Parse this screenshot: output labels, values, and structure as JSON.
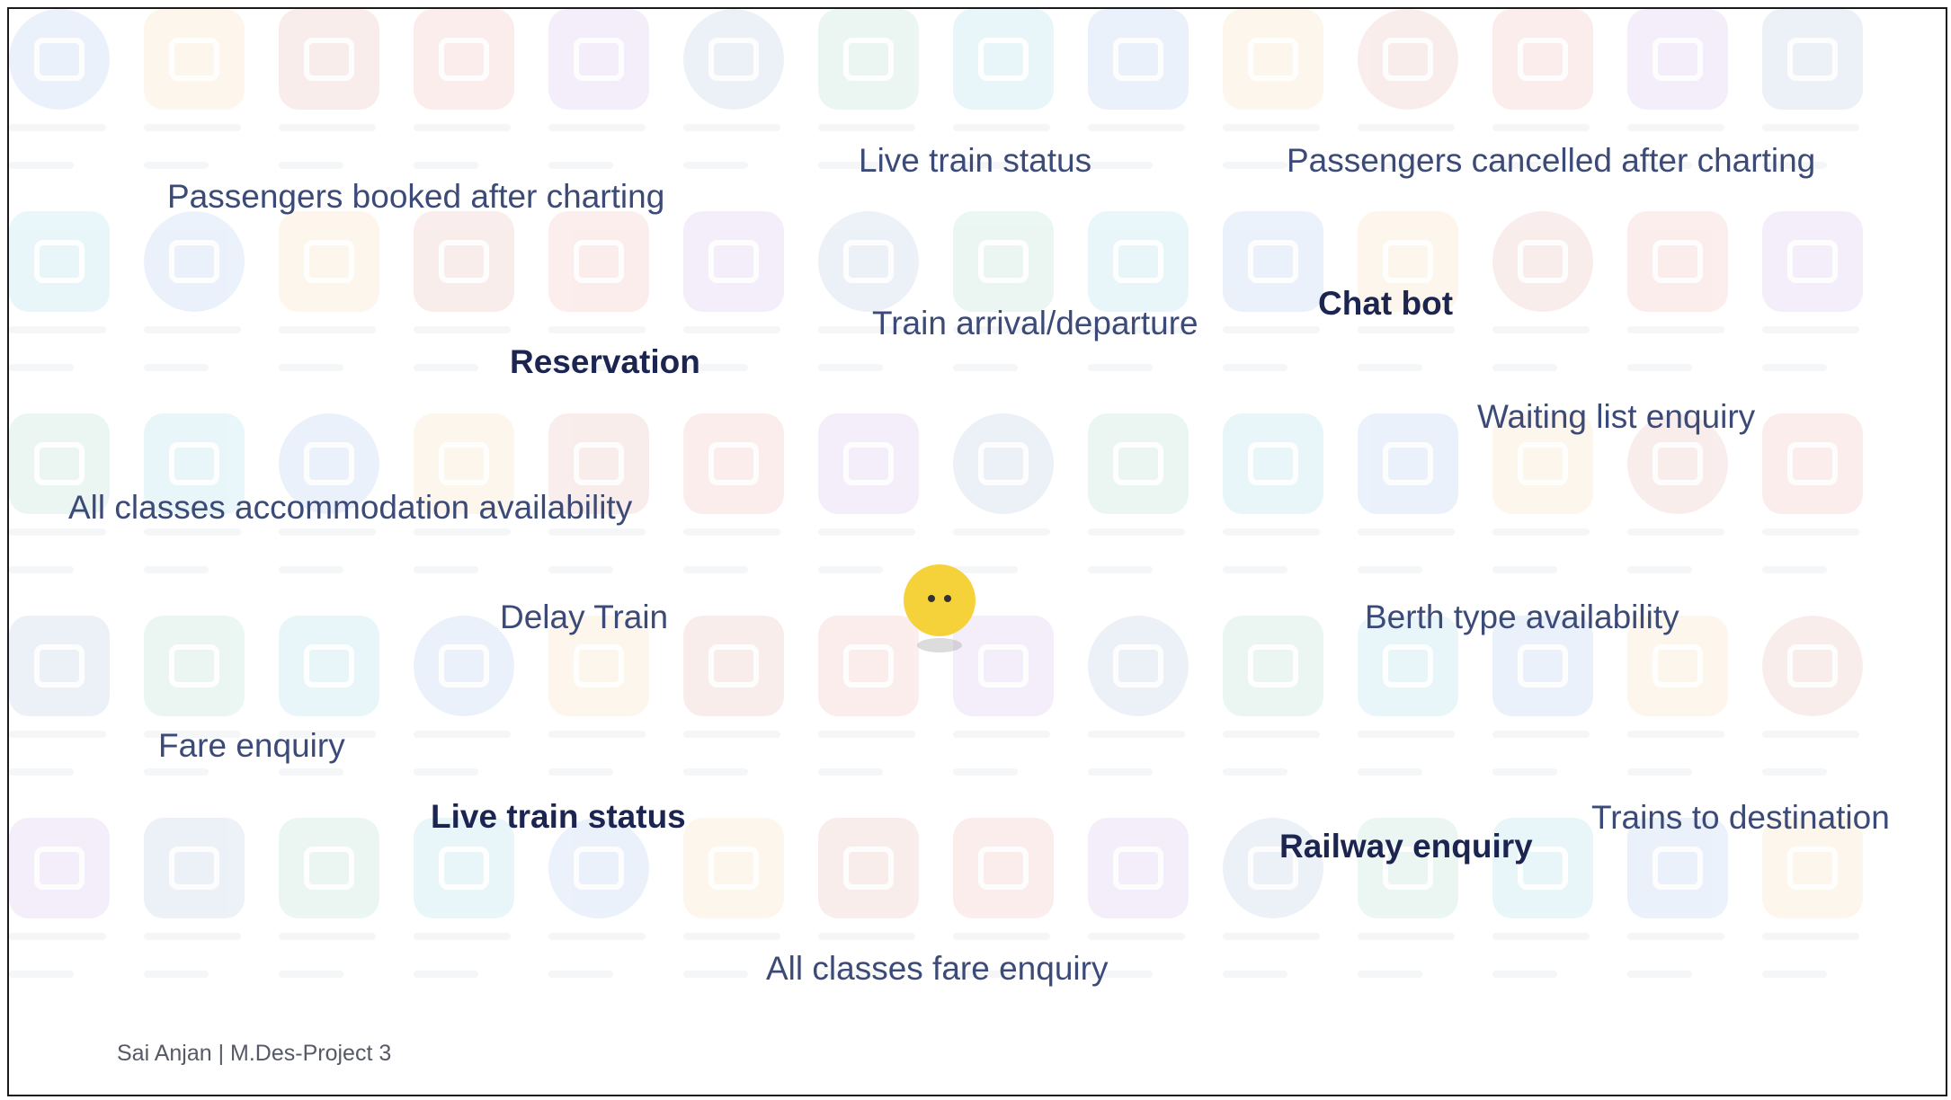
{
  "labels": {
    "passengers_booked": "Passengers booked after charting",
    "live_train_status_top": "Live train status",
    "passengers_cancelled": "Passengers cancelled after charting",
    "train_arrival_departure": "Train arrival/departure",
    "chat_bot": "Chat bot",
    "reservation": "Reservation",
    "waiting_list": "Waiting list enquiry",
    "all_classes_accommodation": "All classes accommodation availability",
    "delay_train": "Delay Train",
    "berth_type": "Berth type availability",
    "fare_enquiry": "Fare enquiry",
    "live_train_status_bold": "Live train status",
    "railway_enquiry": "Railway enquiry",
    "trains_to_destination": "Trains to destination",
    "all_classes_fare": "All classes fare enquiry"
  },
  "footer": "Sai Anjan | M.Des-Project 3",
  "icons": {
    "background": "railway-app-icon",
    "assistant": "chatbot-face-icon"
  },
  "colors": {
    "label_text": "#3c4a78",
    "label_bold": "#1c2550",
    "bot_yellow": "#f6d23a",
    "icon_palette": [
      "#2f6fdb",
      "#d8453a",
      "#2aa57a",
      "#f2a23a",
      "#8a4fc9",
      "#1aa7c7",
      "#c9443b",
      "#3b6fb6"
    ]
  }
}
